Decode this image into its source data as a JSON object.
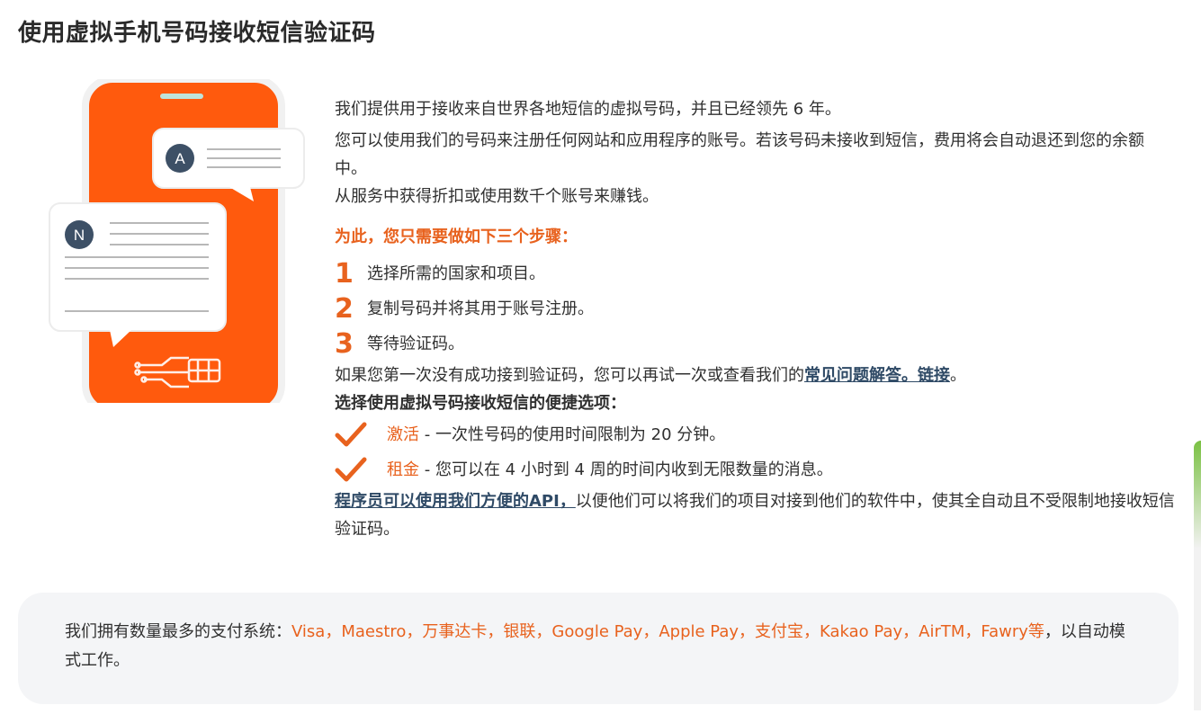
{
  "title": "使用虚拟手机号码接收短信验证码",
  "illustration": {
    "bubble_top_letter": "A",
    "bubble_bottom_letter": "N",
    "colors": {
      "phone": "#ff5a0d",
      "avatar": "#3d5066"
    }
  },
  "intro": {
    "line1": "我们提供用于接收来自世界各地短信的虚拟号码，并且已经领先 6 年。",
    "line2": "您可以使用我们的号码来注册任何网站和应用程序的账号。若该号码未接收到短信，费用将会自动退还到您的余额中。",
    "line3": "从服务中获得折扣或使用数千个账号来赚钱。"
  },
  "steps": {
    "title": "为此，您只需要做如下三个步骤：",
    "items": [
      {
        "num": "1",
        "text": "选择所需的国家和项目。"
      },
      {
        "num": "2",
        "text": "复制号码并将其用于账号注册。"
      },
      {
        "num": "3",
        "text": "等待验证码。"
      }
    ]
  },
  "retry": {
    "text": "如果您第一次没有成功接到验证码，您可以再试一次或查看我们的",
    "link": "常见问题解答。链接",
    "end": "。"
  },
  "options": {
    "title": "选择使用虚拟号码接收短信的便捷选项：",
    "items": [
      {
        "name": "激活",
        "desc": " - 一次性号码的使用时间限制为 20 分钟。"
      },
      {
        "name": "租金",
        "desc": " - 您可以在 4 小时到 4 周的时间内收到无限数量的消息。"
      }
    ]
  },
  "api": {
    "link": "程序员可以使用我们方便的API，",
    "text": "以便他们可以将我们的项目对接到他们的软件中，使其全自动且不受限制地接收短信验证码。"
  },
  "payments": {
    "prefix": "我们拥有数量最多的支付系统：",
    "list": "Visa，Maestro，万事达卡，银联，Google Pay，Apple Pay，支付宝，Kakao Pay，AirTM，Fawry等",
    "suffix": "，以自动模式工作。"
  },
  "accent_color": "#e8621e"
}
